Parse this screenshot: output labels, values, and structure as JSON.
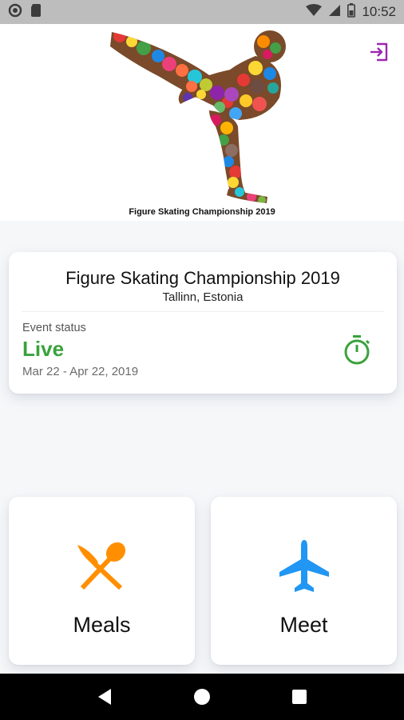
{
  "status_bar": {
    "time": "10:52",
    "icons": [
      "notification-icon",
      "sim-card-icon",
      "wifi-icon",
      "signal-icon",
      "battery-icon"
    ]
  },
  "hero": {
    "caption": "Figure Skating Championship 2019",
    "logout_icon": "logout-icon",
    "accent_color": "#9c27b0"
  },
  "event": {
    "title": "Figure Skating Championship 2019",
    "location": "Tallinn, Estonia",
    "status_label": "Event status",
    "status_value": "Live",
    "dates": "Mar 22 - Apr 22, 2019",
    "status_color": "#3aa23d",
    "timer_icon": "stopwatch-icon"
  },
  "tiles": [
    {
      "label": "Meals",
      "icon": "fork-spoon-icon",
      "color": "#ff8f00"
    },
    {
      "label": "Meet",
      "icon": "airplane-icon",
      "color": "#2196f3"
    }
  ],
  "nav_bar": {
    "icons": [
      "back-icon",
      "home-icon",
      "recents-icon"
    ]
  }
}
